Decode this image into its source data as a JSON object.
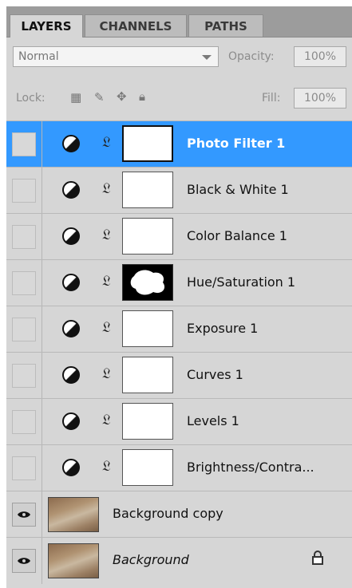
{
  "tabs": [
    {
      "label": "LAYERS",
      "active": true
    },
    {
      "label": "CHANNELS",
      "active": false
    },
    {
      "label": "PATHS",
      "active": false
    }
  ],
  "controls": {
    "blend_mode": "Normal",
    "opacity_label": "Opacity:",
    "opacity_value": "100%",
    "lock_label": "Lock:",
    "fill_label": "Fill:",
    "fill_value": "100%"
  },
  "layers": [
    {
      "name": "Photo Filter 1",
      "type": "adjustment",
      "selected": true,
      "visible": false
    },
    {
      "name": "Black & White 1",
      "type": "adjustment",
      "selected": false,
      "visible": false
    },
    {
      "name": "Color Balance 1",
      "type": "adjustment",
      "selected": false,
      "visible": false
    },
    {
      "name": "Hue/Saturation 1",
      "type": "adjustment",
      "selected": false,
      "visible": false
    },
    {
      "name": "Exposure 1",
      "type": "adjustment",
      "selected": false,
      "visible": false
    },
    {
      "name": "Curves 1",
      "type": "adjustment",
      "selected": false,
      "visible": false
    },
    {
      "name": "Levels 1",
      "type": "adjustment",
      "selected": false,
      "visible": false
    },
    {
      "name": "Brightness/Contra...",
      "type": "adjustment",
      "selected": false,
      "visible": false
    },
    {
      "name": "Background copy",
      "type": "image",
      "selected": false,
      "visible": true
    },
    {
      "name": "Background",
      "type": "image",
      "selected": false,
      "visible": true,
      "locked": true
    }
  ],
  "colors": {
    "selection": "#3399ff",
    "panel": "#d6d6d6"
  }
}
